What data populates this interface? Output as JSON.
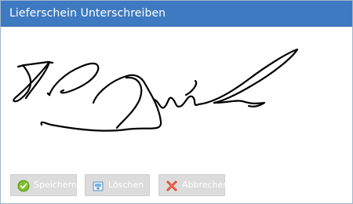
{
  "window": {
    "title": "Lieferschein Unterschreiben"
  },
  "buttons": {
    "save_label": "Speichern",
    "clear_label": "Löschen",
    "cancel_label": "Abbrechen"
  },
  "icons": {
    "save": "check-circle-icon",
    "clear": "eraser-icon",
    "cancel": "red-x-icon"
  },
  "colors": {
    "titlebar": "#3e7ac1",
    "button_bg": "#dcdcdc",
    "ink": "#000000"
  }
}
